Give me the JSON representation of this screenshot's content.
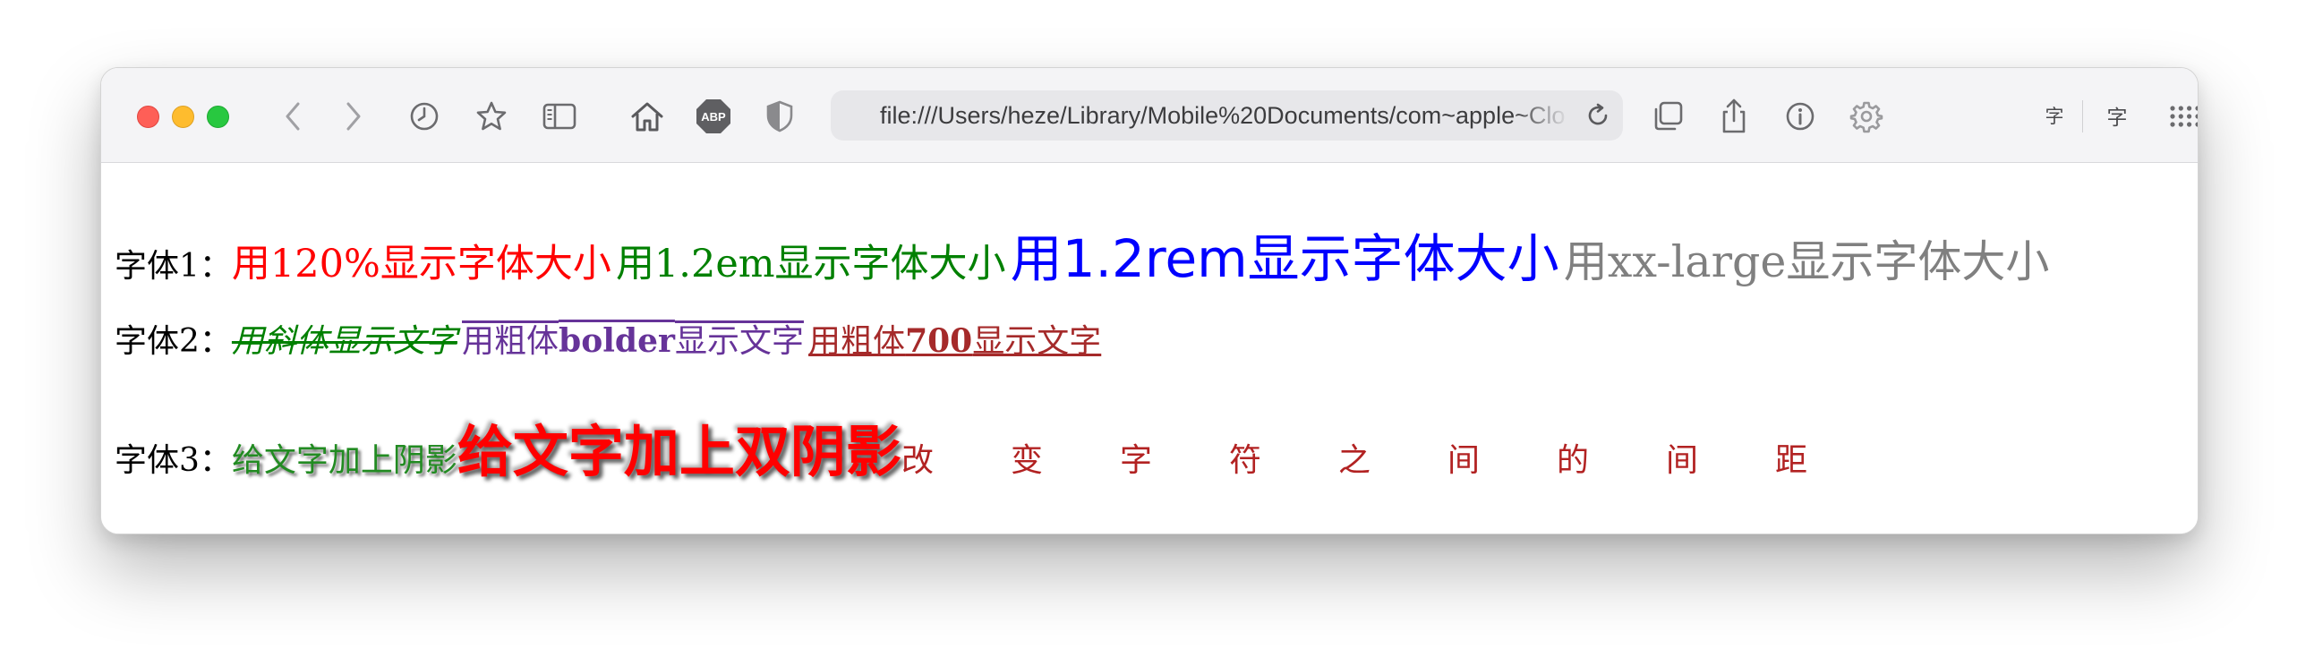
{
  "window": {
    "url": "file:///Users/heze/Library/Mobile%20Documents/com~apple~Clo",
    "toolbar_glyph_1": "字",
    "toolbar_glyph_2": "字",
    "toolbar_glyph_plus": "+",
    "abp_label": "ABP",
    "icons": [
      "back-icon",
      "forward-icon",
      "history-icon",
      "bookmark-star-icon",
      "sidebar-icon",
      "home-icon",
      "adblock-plus-icon",
      "privacy-shield-icon",
      "reload-icon",
      "tabs-overview-icon",
      "share-icon",
      "info-icon",
      "settings-gear-icon",
      "text-size-icon",
      "grid-icon",
      "new-tab-icon"
    ]
  },
  "content": {
    "row1": {
      "label": "字体1：",
      "s1": "用120%显示字体大小",
      "s2": "用1.2em显示字体大小",
      "s3": "用1.2rem显示字体大小",
      "s4": "用xx-large显示字体大小"
    },
    "row2": {
      "label": "字体2：",
      "s1": "用斜体显示文字",
      "s2_pre": "用粗体",
      "s2_bold": "bolder",
      "s2_post": "显示文字",
      "s3_pre": "用粗体",
      "s3_bold": "700",
      "s3_post": "显示文字"
    },
    "row3": {
      "label": "字体3：",
      "s1": "给文字加上阴影",
      "s2": "给文字加上双阴影",
      "s3": "改变字符之间的间距"
    }
  },
  "colors": {
    "red": "#ff0000",
    "green": "#008000",
    "blue": "#0000ff",
    "gray": "#808080",
    "purple": "#663399",
    "brown": "#a52a2a"
  }
}
